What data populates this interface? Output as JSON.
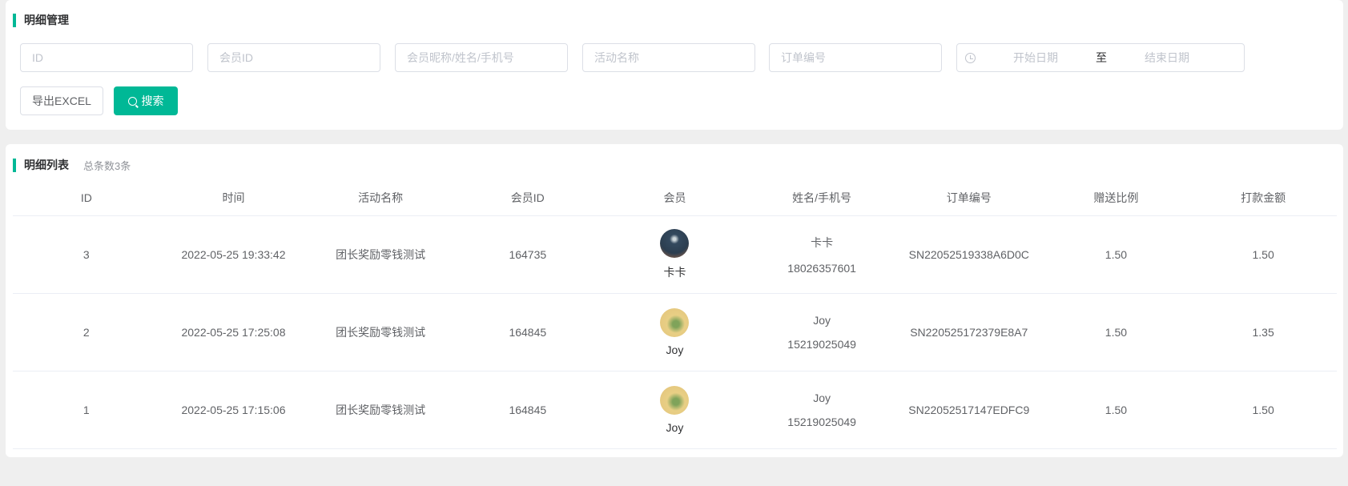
{
  "filter": {
    "title": "明细管理",
    "placeholders": {
      "id": "ID",
      "member_id": "会员ID",
      "member_info": "会员昵称/姓名/手机号",
      "activity": "活动名称",
      "order_no": "订单编号",
      "start_date": "开始日期",
      "end_date": "结束日期"
    },
    "range_sep": "至",
    "export_label": "导出EXCEL",
    "search_label": "搜索"
  },
  "list": {
    "title": "明细列表",
    "total": "总条数3条",
    "columns": [
      "ID",
      "时间",
      "活动名称",
      "会员ID",
      "会员",
      "姓名/手机号",
      "订单编号",
      "赠送比例",
      "打款金额"
    ],
    "rows": [
      {
        "id": "3",
        "time": "2022-05-25 19:33:42",
        "activity": "团长奖励零钱测试",
        "member_id": "164735",
        "member": "卡卡",
        "name": "卡卡",
        "phone": "18026357601",
        "order_no": "SN22052519338A6D0C",
        "ratio": "1.50",
        "amount": "1.50"
      },
      {
        "id": "2",
        "time": "2022-05-25 17:25:08",
        "activity": "团长奖励零钱测试",
        "member_id": "164845",
        "member": "Joy",
        "name": "Joy",
        "phone": "15219025049",
        "order_no": "SN220525172379E8A7",
        "ratio": "1.50",
        "amount": "1.35"
      },
      {
        "id": "1",
        "time": "2022-05-25 17:15:06",
        "activity": "团长奖励零钱测试",
        "member_id": "164845",
        "member": "Joy",
        "name": "Joy",
        "phone": "15219025049",
        "order_no": "SN22052517147EDFC9",
        "ratio": "1.50",
        "amount": "1.50"
      }
    ]
  },
  "colors": {
    "accent": "#00b896"
  }
}
